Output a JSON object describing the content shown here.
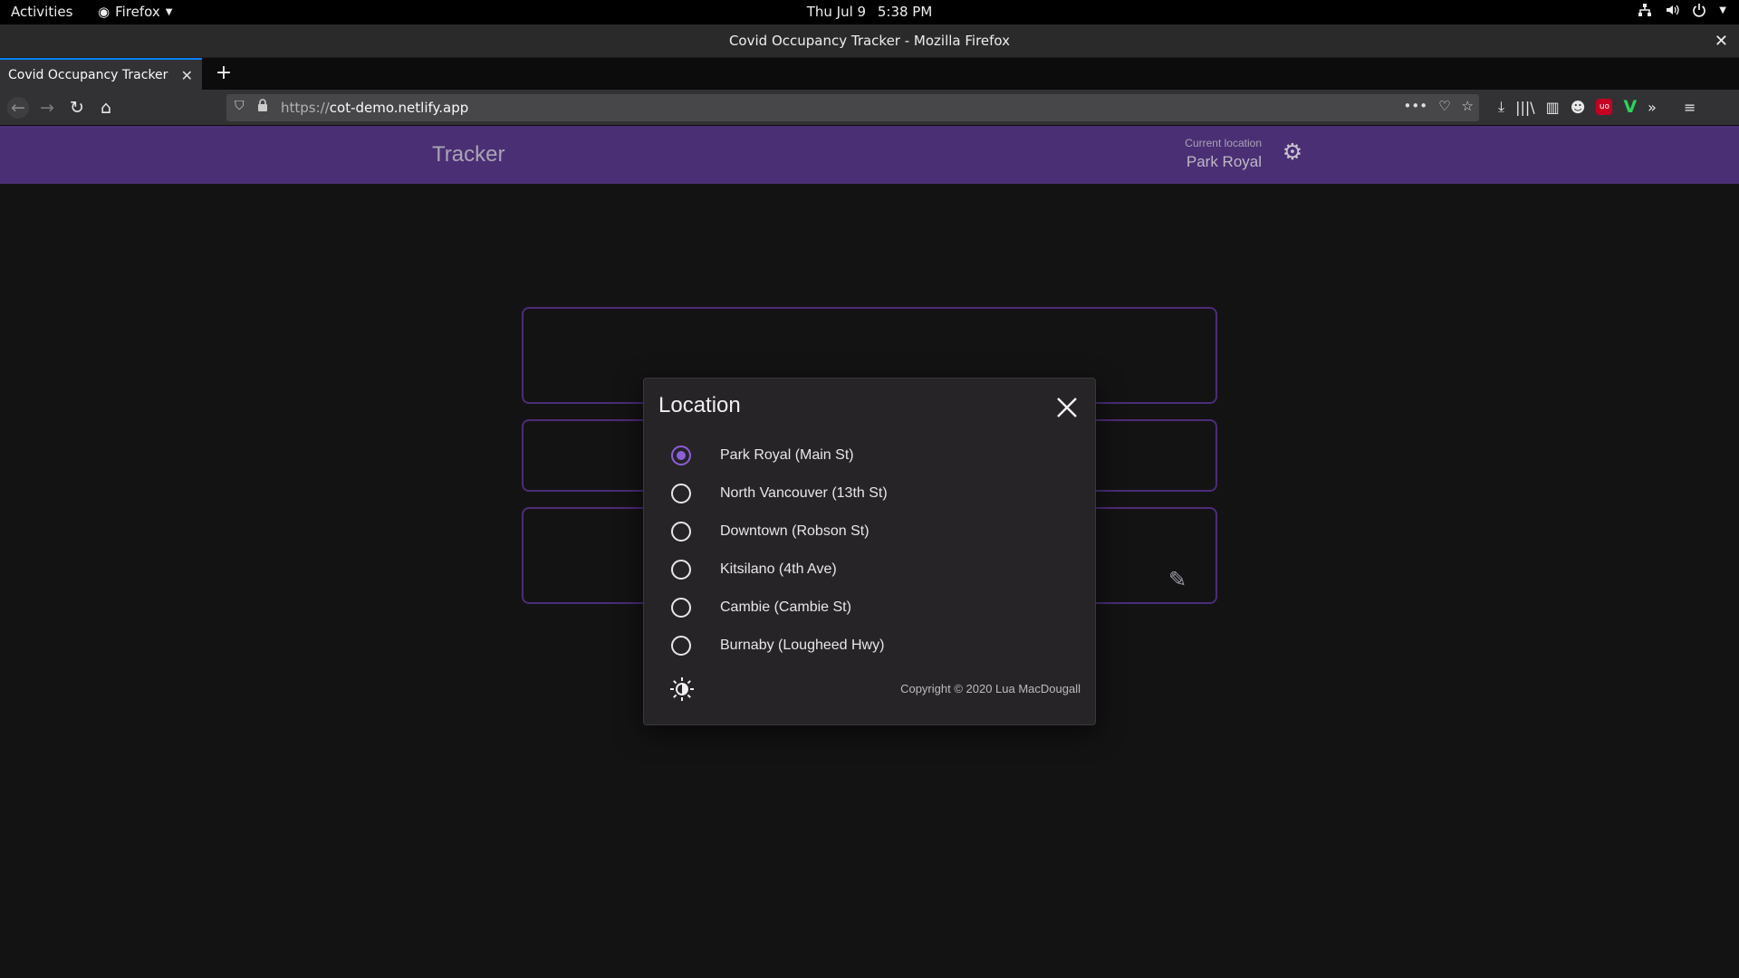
{
  "system_bar": {
    "activities": "Activities",
    "app_menu": "Firefox",
    "date": "Thu Jul 9",
    "time": "5:38 PM"
  },
  "window": {
    "title": "Covid Occupancy Tracker - Mozilla Firefox"
  },
  "tabs": [
    {
      "label": "Covid Occupancy Tracker",
      "active": true
    }
  ],
  "urlbar": {
    "scheme": "https://",
    "host": "cot-demo.netlify.app"
  },
  "app": {
    "title": "Tracker",
    "current_location_caption": "Current location",
    "current_location_value": "Park Royal",
    "accent_color": "#4b2f74"
  },
  "dialog": {
    "title": "Location",
    "options": [
      {
        "label": "Park Royal (Main St)",
        "selected": true
      },
      {
        "label": "North Vancouver (13th St)",
        "selected": false
      },
      {
        "label": "Downtown (Robson St)",
        "selected": false
      },
      {
        "label": "Kitsilano (4th Ave)",
        "selected": false
      },
      {
        "label": "Cambie (Cambie St)",
        "selected": false
      },
      {
        "label": "Burnaby (Lougheed Hwy)",
        "selected": false
      }
    ],
    "copyright": "Copyright © 2020 Lua MacDougall",
    "radio_color": "#8c5fd9"
  }
}
